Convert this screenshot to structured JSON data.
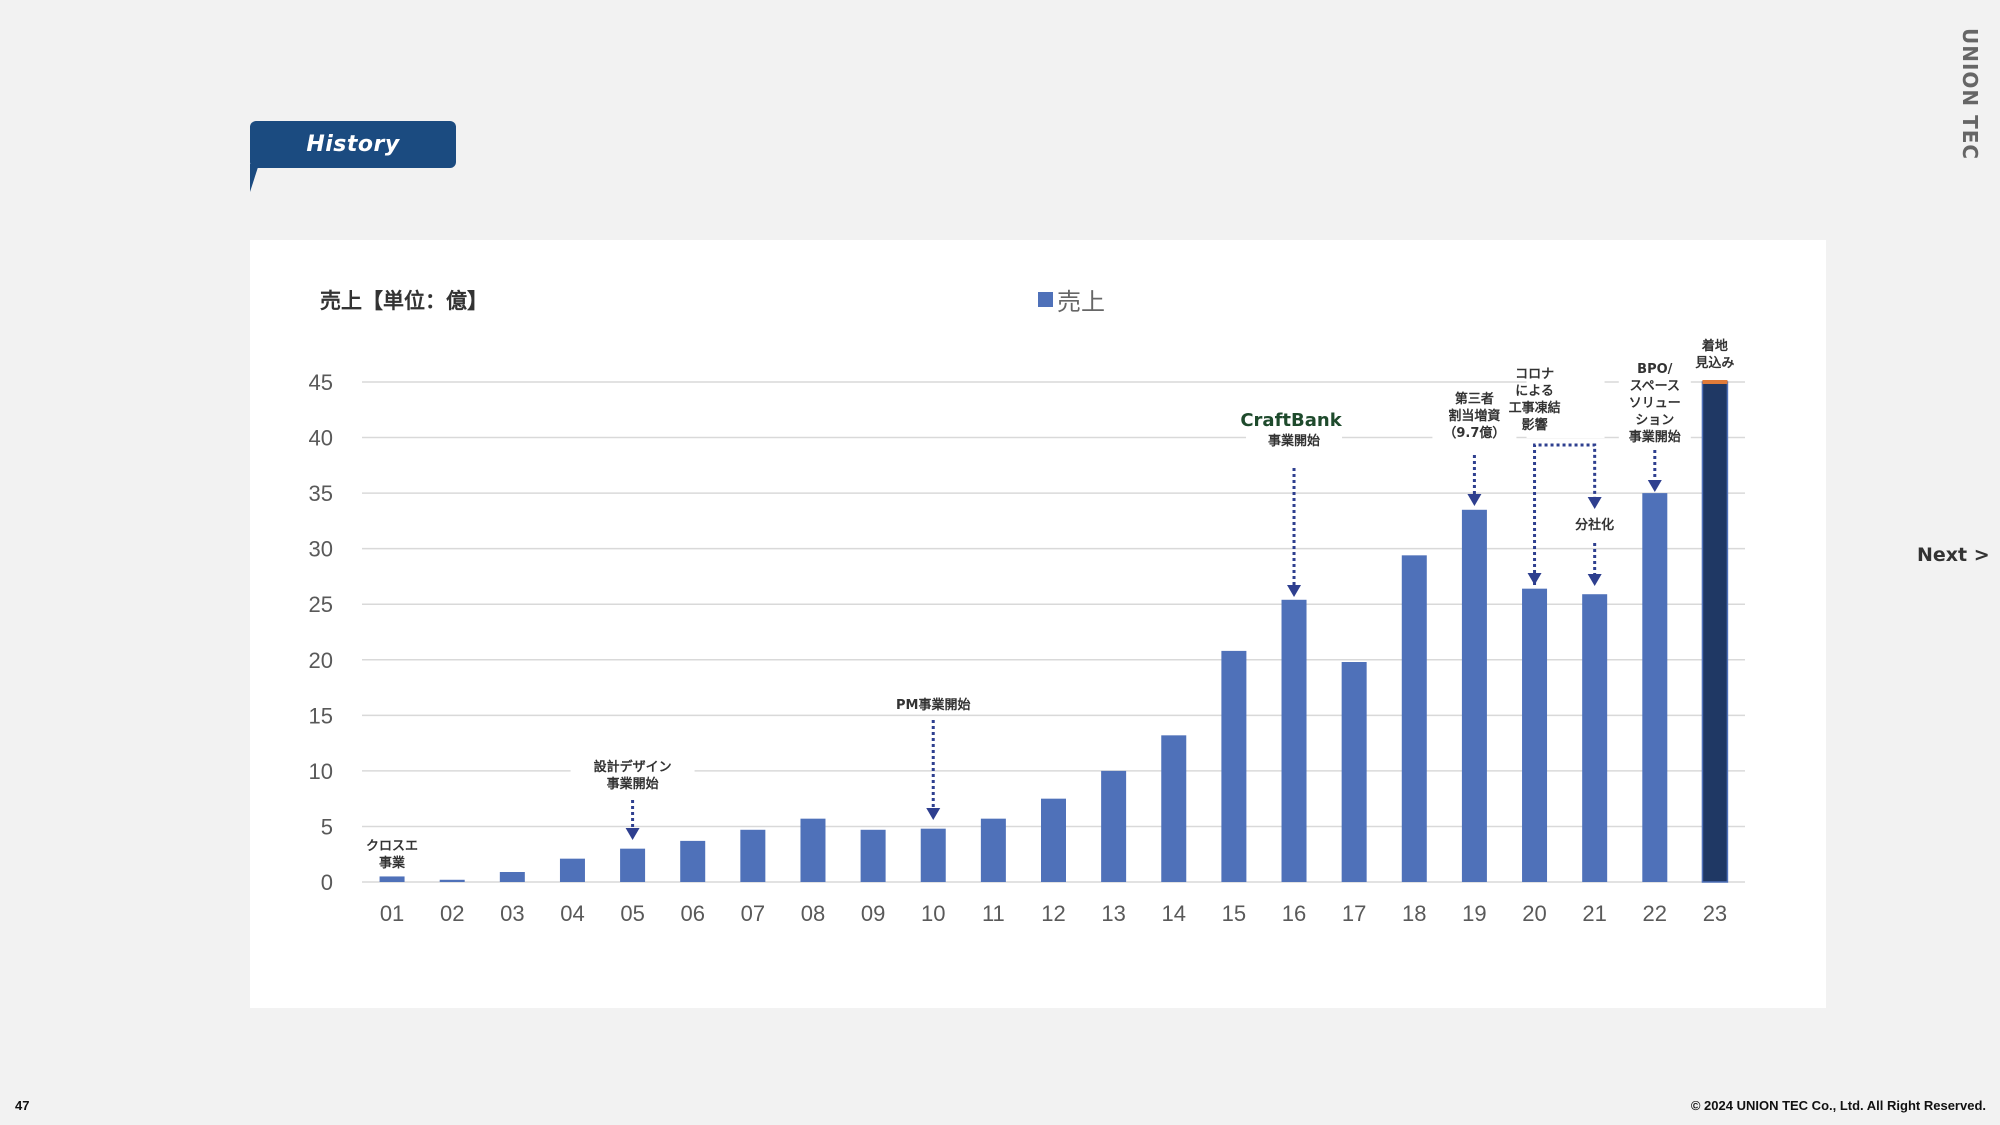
{
  "header": {
    "tag_label": "History",
    "brand": "UNION TEC"
  },
  "nav": {
    "next_label": "Next >"
  },
  "footer": {
    "page_number": "47",
    "copyright": "© 2024 UNION TEC Co., Ltd. All Right Reserved."
  },
  "colors": {
    "bar": "#4f71b9",
    "forecast_bar": "#1f3864",
    "forecast_cap": "#e07b39",
    "tag": "#1b4b80",
    "arrow": "#2e3f8f",
    "grid": "#d9d9d9"
  },
  "chart_data": {
    "type": "bar",
    "title": "売上【単位：億】",
    "legend": [
      "売上"
    ],
    "legend_position": "top-center",
    "xlabel": "",
    "ylabel": "",
    "ylim": [
      0,
      45
    ],
    "yticks": [
      0,
      5,
      10,
      15,
      20,
      25,
      30,
      35,
      40,
      45
    ],
    "grid": true,
    "categories": [
      "01",
      "02",
      "03",
      "04",
      "05",
      "06",
      "07",
      "08",
      "09",
      "10",
      "11",
      "12",
      "13",
      "14",
      "15",
      "16",
      "17",
      "18",
      "19",
      "20",
      "21",
      "22",
      "23"
    ],
    "series": [
      {
        "name": "売上",
        "values": [
          0.5,
          0.2,
          0.9,
          2.1,
          3.0,
          3.7,
          4.7,
          5.7,
          4.7,
          4.8,
          5.7,
          7.5,
          10.0,
          13.2,
          20.8,
          25.4,
          19.8,
          29.4,
          33.5,
          26.4,
          25.9,
          35.0,
          45.0
        ]
      }
    ],
    "forecast_category": "23",
    "annotations": [
      {
        "category": "01",
        "lines": [
          "クロスエ",
          "事業"
        ],
        "arrow": false
      },
      {
        "category": "05",
        "lines": [
          "設計デザイン",
          "事業開始"
        ],
        "arrow": true
      },
      {
        "category": "10",
        "lines": [
          "PM事業開始"
        ],
        "arrow": true
      },
      {
        "category": "16",
        "logo": "CraftBank",
        "lines": [
          "事業開始"
        ],
        "arrow": true
      },
      {
        "category": "19",
        "lines": [
          "第三者",
          "割当増資",
          "（9.7億）"
        ],
        "arrow": true
      },
      {
        "category": "20-21",
        "lines": [
          "コロナ",
          "による",
          "工事凍結",
          "影響"
        ],
        "arrow": true
      },
      {
        "category": "21",
        "lines": [
          "分社化"
        ],
        "arrow": true
      },
      {
        "category": "22",
        "lines": [
          "BPO/",
          "スペース",
          "ソリュー",
          "ション",
          "事業開始"
        ],
        "arrow": true
      },
      {
        "category": "23",
        "lines": [
          "着地",
          "見込み"
        ],
        "arrow": false
      }
    ]
  }
}
